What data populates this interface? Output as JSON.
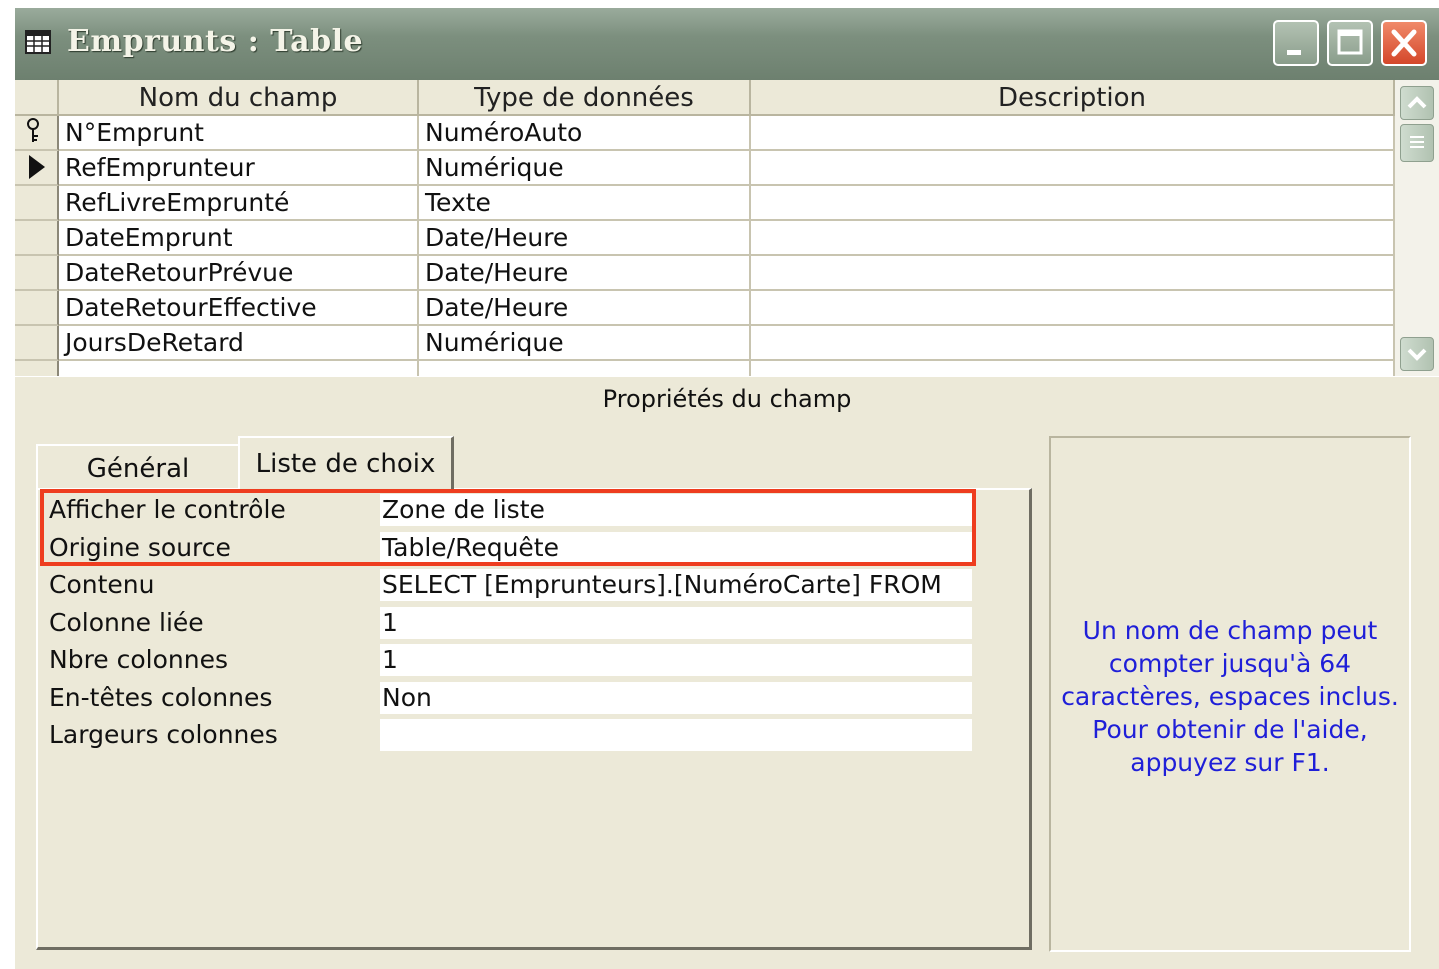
{
  "window": {
    "title": "Emprunts : Table",
    "icons": {
      "app": "table-icon",
      "minimize": "minimize-icon",
      "maximize": "maximize-icon",
      "close": "close-icon"
    }
  },
  "grid": {
    "headers": {
      "name": "Nom du champ",
      "type": "Type de données",
      "description": "Description"
    },
    "rows": [
      {
        "name": "N°Emprunt",
        "type": "NuméroAuto",
        "description": "",
        "indicator": "key-icon"
      },
      {
        "name": "RefEmprunteur",
        "type": "Numérique",
        "description": "",
        "indicator": "row-pointer-icon"
      },
      {
        "name": "RefLivreEmprunté",
        "type": "Texte",
        "description": ""
      },
      {
        "name": "DateEmprunt",
        "type": "Date/Heure",
        "description": ""
      },
      {
        "name": "DateRetourPrévue",
        "type": "Date/Heure",
        "description": ""
      },
      {
        "name": "DateRetourEffective",
        "type": "Date/Heure",
        "description": ""
      },
      {
        "name": "JoursDeRetard",
        "type": "Numérique",
        "description": ""
      }
    ]
  },
  "properties": {
    "section_title": "Propriétés du champ",
    "tabs": {
      "general": "Général",
      "liste": "Liste de choix"
    },
    "active_tab": "Liste de choix",
    "items": [
      {
        "label": "Afficher le contrôle",
        "value": "Zone de liste"
      },
      {
        "label": "Origine source",
        "value": "Table/Requête"
      },
      {
        "label": "Contenu",
        "value": "SELECT [Emprunteurs].[NuméroCarte] FROM"
      },
      {
        "label": "Colonne liée",
        "value": "1"
      },
      {
        "label": "Nbre colonnes",
        "value": "1"
      },
      {
        "label": "En-têtes colonnes",
        "value": "Non"
      },
      {
        "label": "Largeurs colonnes",
        "value": ""
      }
    ],
    "highlight_color": "#ee3d1f"
  },
  "help": {
    "line1": "Un nom de champ peut",
    "line2": "compter jusqu'à 64",
    "line3": "caractères, espaces inclus.",
    "line4": "Pour obtenir de l'aide,",
    "line5": "appuyez sur F1."
  },
  "colors": {
    "window_bg": "#ece9d8",
    "titlebar": "#7c8f7e",
    "help_text": "#1f1fd8"
  }
}
